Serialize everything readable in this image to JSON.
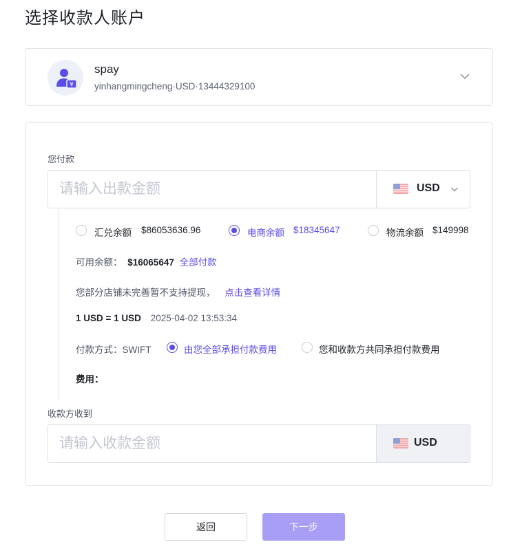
{
  "page": {
    "title": "选择收款人账户"
  },
  "account": {
    "name": "spay",
    "detail": "yinhangmingcheng·USD·13444329100"
  },
  "pay": {
    "label": "您付款",
    "placeholder": "请输入出款金额",
    "currency": "USD"
  },
  "balances": [
    {
      "label": "汇兑余额",
      "value": "$86053636.96",
      "selected": false
    },
    {
      "label": "电商余额",
      "value": "$18345647",
      "selected": true
    },
    {
      "label": "物流余额",
      "value": "$149998",
      "selected": false
    }
  ],
  "available": {
    "label": "可用余额：",
    "value": "$16065647",
    "action": "全部付款"
  },
  "notice": {
    "text": "您部分店铺未完善暂不支持提现，",
    "link": "点击查看详情"
  },
  "rate": {
    "text": "1 USD = 1 USD",
    "time": "2025-04-02 13:53:34"
  },
  "payment_method": {
    "label": "付款方式：SWIFT",
    "options": [
      {
        "label": "由您全部承担付款费用",
        "selected": true
      },
      {
        "label": "您和收款方共同承担付款费用",
        "selected": false
      }
    ]
  },
  "fee": {
    "label": "费用："
  },
  "receive": {
    "label": "收款方收到",
    "placeholder": "请输入收款金额",
    "currency": "USD"
  },
  "buttons": {
    "back": "返回",
    "next": "下一步"
  },
  "colors": {
    "accent": "#5b4de8",
    "next_button": "#a99ef5",
    "border": "#e3e5ea"
  },
  "icons": {
    "avatar": "user-money-icon",
    "flag": "us-flag-icon",
    "dropdown": "chevron-down-icon"
  }
}
